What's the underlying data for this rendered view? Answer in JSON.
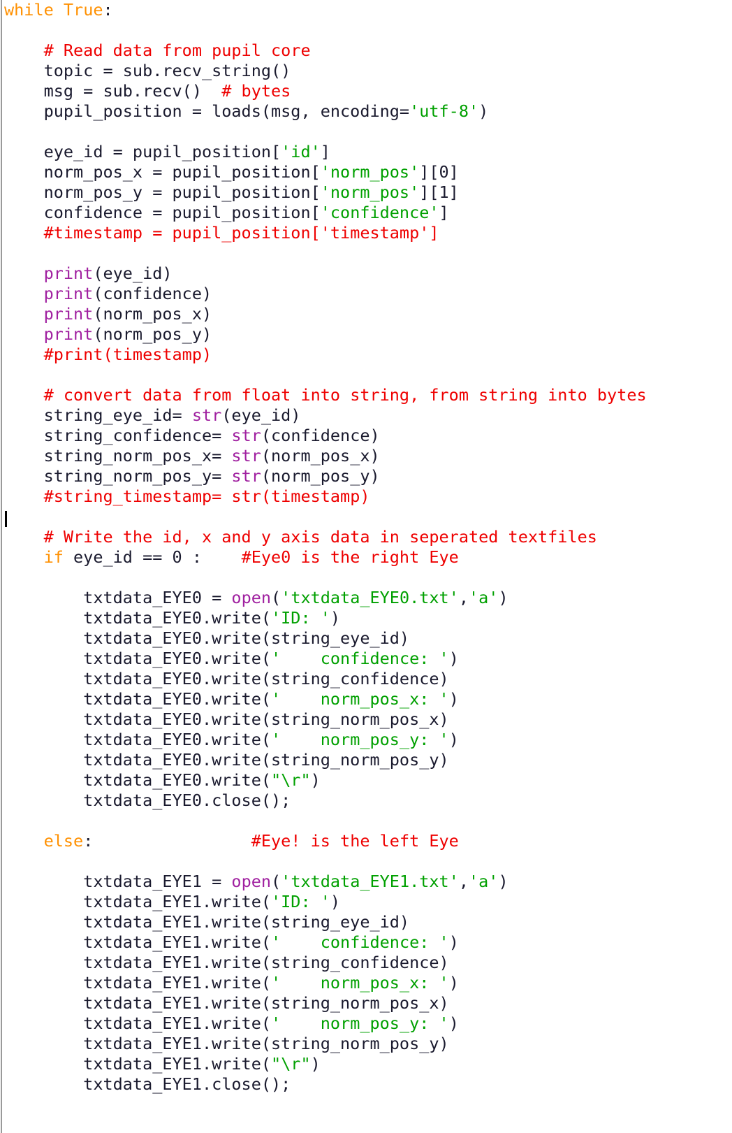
{
  "editor": {
    "language": "Python",
    "caret_line_index": 25,
    "colors": {
      "background": "#ffffff",
      "default_text": "#1a1a2e",
      "keyword": "#ff9000",
      "builtin": "#a020a0",
      "string": "#00a000",
      "comment": "#ee0000",
      "caret": "#000000",
      "gutter_rule": "#9a9a9a"
    }
  },
  "code": {
    "lines": [
      {
        "n": 1,
        "text": "while True:",
        "tokens": [
          {
            "t": "while",
            "c": "kw"
          },
          {
            "t": " ",
            "c": "plain"
          },
          {
            "t": "True",
            "c": "kw"
          },
          {
            "t": ":",
            "c": "plain"
          }
        ]
      },
      {
        "n": 2,
        "text": "",
        "tokens": []
      },
      {
        "n": 3,
        "text": "    # Read data from pupil core",
        "tokens": [
          {
            "t": "    ",
            "c": "plain"
          },
          {
            "t": "# Read data from pupil core",
            "c": "com"
          }
        ]
      },
      {
        "n": 4,
        "text": "    topic = sub.recv_string()",
        "tokens": [
          {
            "t": "    topic = sub.recv_string()",
            "c": "plain"
          }
        ]
      },
      {
        "n": 5,
        "text": "    msg = sub.recv()  # bytes",
        "tokens": [
          {
            "t": "    msg = sub.recv()  ",
            "c": "plain"
          },
          {
            "t": "# bytes",
            "c": "com"
          }
        ]
      },
      {
        "n": 6,
        "text": "    pupil_position = loads(msg, encoding='utf-8')",
        "tokens": [
          {
            "t": "    pupil_position = loads(msg, encoding=",
            "c": "plain"
          },
          {
            "t": "'utf-8'",
            "c": "str"
          },
          {
            "t": ")",
            "c": "plain"
          }
        ]
      },
      {
        "n": 7,
        "text": "",
        "tokens": []
      },
      {
        "n": 8,
        "text": "    eye_id = pupil_position['id']",
        "tokens": [
          {
            "t": "    eye_id = pupil_position[",
            "c": "plain"
          },
          {
            "t": "'id'",
            "c": "str"
          },
          {
            "t": "]",
            "c": "plain"
          }
        ]
      },
      {
        "n": 9,
        "text": "    norm_pos_x = pupil_position['norm_pos'][0]",
        "tokens": [
          {
            "t": "    norm_pos_x = pupil_position[",
            "c": "plain"
          },
          {
            "t": "'norm_pos'",
            "c": "str"
          },
          {
            "t": "][0]",
            "c": "plain"
          }
        ]
      },
      {
        "n": 10,
        "text": "    norm_pos_y = pupil_position['norm_pos'][1]",
        "tokens": [
          {
            "t": "    norm_pos_y = pupil_position[",
            "c": "plain"
          },
          {
            "t": "'norm_pos'",
            "c": "str"
          },
          {
            "t": "][1]",
            "c": "plain"
          }
        ]
      },
      {
        "n": 11,
        "text": "    confidence = pupil_position['confidence']",
        "tokens": [
          {
            "t": "    confidence = pupil_position[",
            "c": "plain"
          },
          {
            "t": "'confidence'",
            "c": "str"
          },
          {
            "t": "]",
            "c": "plain"
          }
        ]
      },
      {
        "n": 12,
        "text": "    #timestamp = pupil_position['timestamp']",
        "tokens": [
          {
            "t": "    ",
            "c": "plain"
          },
          {
            "t": "#timestamp = pupil_position['timestamp']",
            "c": "com"
          }
        ]
      },
      {
        "n": 13,
        "text": "",
        "tokens": []
      },
      {
        "n": 14,
        "text": "    print(eye_id)",
        "tokens": [
          {
            "t": "    ",
            "c": "plain"
          },
          {
            "t": "print",
            "c": "builtin"
          },
          {
            "t": "(eye_id)",
            "c": "plain"
          }
        ]
      },
      {
        "n": 15,
        "text": "    print(confidence)",
        "tokens": [
          {
            "t": "    ",
            "c": "plain"
          },
          {
            "t": "print",
            "c": "builtin"
          },
          {
            "t": "(confidence)",
            "c": "plain"
          }
        ]
      },
      {
        "n": 16,
        "text": "    print(norm_pos_x)",
        "tokens": [
          {
            "t": "    ",
            "c": "plain"
          },
          {
            "t": "print",
            "c": "builtin"
          },
          {
            "t": "(norm_pos_x)",
            "c": "plain"
          }
        ]
      },
      {
        "n": 17,
        "text": "    print(norm_pos_y)",
        "tokens": [
          {
            "t": "    ",
            "c": "plain"
          },
          {
            "t": "print",
            "c": "builtin"
          },
          {
            "t": "(norm_pos_y)",
            "c": "plain"
          }
        ]
      },
      {
        "n": 18,
        "text": "    #print(timestamp)",
        "tokens": [
          {
            "t": "    ",
            "c": "plain"
          },
          {
            "t": "#print(timestamp)",
            "c": "com"
          }
        ]
      },
      {
        "n": 19,
        "text": "",
        "tokens": []
      },
      {
        "n": 20,
        "text": "    # convert data from float into string, from string into bytes",
        "tokens": [
          {
            "t": "    ",
            "c": "plain"
          },
          {
            "t": "# convert data from float into string, from string into bytes",
            "c": "com"
          }
        ]
      },
      {
        "n": 21,
        "text": "    string_eye_id= str(eye_id)",
        "tokens": [
          {
            "t": "    string_eye_id= ",
            "c": "plain"
          },
          {
            "t": "str",
            "c": "builtin"
          },
          {
            "t": "(eye_id)",
            "c": "plain"
          }
        ]
      },
      {
        "n": 22,
        "text": "    string_confidence= str(confidence)",
        "tokens": [
          {
            "t": "    string_confidence= ",
            "c": "plain"
          },
          {
            "t": "str",
            "c": "builtin"
          },
          {
            "t": "(confidence)",
            "c": "plain"
          }
        ]
      },
      {
        "n": 23,
        "text": "    string_norm_pos_x= str(norm_pos_x)",
        "tokens": [
          {
            "t": "    string_norm_pos_x= ",
            "c": "plain"
          },
          {
            "t": "str",
            "c": "builtin"
          },
          {
            "t": "(norm_pos_x)",
            "c": "plain"
          }
        ]
      },
      {
        "n": 24,
        "text": "    string_norm_pos_y= str(norm_pos_y)",
        "tokens": [
          {
            "t": "    string_norm_pos_y= ",
            "c": "plain"
          },
          {
            "t": "str",
            "c": "builtin"
          },
          {
            "t": "(norm_pos_y)",
            "c": "plain"
          }
        ]
      },
      {
        "n": 25,
        "text": "    #string_timestamp= str(timestamp)",
        "tokens": [
          {
            "t": "    ",
            "c": "plain"
          },
          {
            "t": "#string_timestamp= str(timestamp)",
            "c": "com"
          }
        ]
      },
      {
        "n": 26,
        "text": "",
        "tokens": []
      },
      {
        "n": 27,
        "text": "    # Write the id, x and y axis data in seperated textfiles",
        "tokens": [
          {
            "t": "    ",
            "c": "plain"
          },
          {
            "t": "# Write the id, x and y axis data in seperated textfiles",
            "c": "com"
          }
        ]
      },
      {
        "n": 28,
        "text": "    if eye_id == 0 :    #Eye0 is the right Eye",
        "tokens": [
          {
            "t": "    ",
            "c": "plain"
          },
          {
            "t": "if",
            "c": "kw"
          },
          {
            "t": " eye_id == 0 :    ",
            "c": "plain"
          },
          {
            "t": "#Eye0 is the right Eye",
            "c": "com"
          }
        ]
      },
      {
        "n": 29,
        "text": "",
        "tokens": []
      },
      {
        "n": 30,
        "text": "        txtdata_EYE0 = open('txtdata_EYE0.txt','a')",
        "tokens": [
          {
            "t": "        txtdata_EYE0 = ",
            "c": "plain"
          },
          {
            "t": "open",
            "c": "builtin"
          },
          {
            "t": "(",
            "c": "plain"
          },
          {
            "t": "'txtdata_EYE0.txt'",
            "c": "str"
          },
          {
            "t": ",",
            "c": "plain"
          },
          {
            "t": "'a'",
            "c": "str"
          },
          {
            "t": ")",
            "c": "plain"
          }
        ]
      },
      {
        "n": 31,
        "text": "        txtdata_EYE0.write('ID: ')",
        "tokens": [
          {
            "t": "        txtdata_EYE0.write(",
            "c": "plain"
          },
          {
            "t": "'ID: '",
            "c": "str"
          },
          {
            "t": ")",
            "c": "plain"
          }
        ]
      },
      {
        "n": 32,
        "text": "        txtdata_EYE0.write(string_eye_id)",
        "tokens": [
          {
            "t": "        txtdata_EYE0.write(string_eye_id)",
            "c": "plain"
          }
        ]
      },
      {
        "n": 33,
        "text": "        txtdata_EYE0.write('    confidence: ')",
        "tokens": [
          {
            "t": "        txtdata_EYE0.write(",
            "c": "plain"
          },
          {
            "t": "'    confidence: '",
            "c": "str"
          },
          {
            "t": ")",
            "c": "plain"
          }
        ]
      },
      {
        "n": 34,
        "text": "        txtdata_EYE0.write(string_confidence)",
        "tokens": [
          {
            "t": "        txtdata_EYE0.write(string_confidence)",
            "c": "plain"
          }
        ]
      },
      {
        "n": 35,
        "text": "        txtdata_EYE0.write('    norm_pos_x: ')",
        "tokens": [
          {
            "t": "        txtdata_EYE0.write(",
            "c": "plain"
          },
          {
            "t": "'    norm_pos_x: '",
            "c": "str"
          },
          {
            "t": ")",
            "c": "plain"
          }
        ]
      },
      {
        "n": 36,
        "text": "        txtdata_EYE0.write(string_norm_pos_x)",
        "tokens": [
          {
            "t": "        txtdata_EYE0.write(string_norm_pos_x)",
            "c": "plain"
          }
        ]
      },
      {
        "n": 37,
        "text": "        txtdata_EYE0.write('    norm_pos_y: ')",
        "tokens": [
          {
            "t": "        txtdata_EYE0.write(",
            "c": "plain"
          },
          {
            "t": "'    norm_pos_y: '",
            "c": "str"
          },
          {
            "t": ")",
            "c": "plain"
          }
        ]
      },
      {
        "n": 38,
        "text": "        txtdata_EYE0.write(string_norm_pos_y)",
        "tokens": [
          {
            "t": "        txtdata_EYE0.write(string_norm_pos_y)",
            "c": "plain"
          }
        ]
      },
      {
        "n": 39,
        "text": "        txtdata_EYE0.write(\"\\r\")",
        "tokens": [
          {
            "t": "        txtdata_EYE0.write(",
            "c": "plain"
          },
          {
            "t": "\"\\r\"",
            "c": "str"
          },
          {
            "t": ")",
            "c": "plain"
          }
        ]
      },
      {
        "n": 40,
        "text": "        txtdata_EYE0.close();",
        "tokens": [
          {
            "t": "        txtdata_EYE0.close();",
            "c": "plain"
          }
        ]
      },
      {
        "n": 41,
        "text": "",
        "tokens": []
      },
      {
        "n": 42,
        "text": "    else:                #Eye! is the left Eye",
        "tokens": [
          {
            "t": "    ",
            "c": "plain"
          },
          {
            "t": "else",
            "c": "kw"
          },
          {
            "t": ":                ",
            "c": "plain"
          },
          {
            "t": "#Eye! is the left Eye",
            "c": "com"
          }
        ]
      },
      {
        "n": 43,
        "text": "",
        "tokens": []
      },
      {
        "n": 44,
        "text": "        txtdata_EYE1 = open('txtdata_EYE1.txt','a')",
        "tokens": [
          {
            "t": "        txtdata_EYE1 = ",
            "c": "plain"
          },
          {
            "t": "open",
            "c": "builtin"
          },
          {
            "t": "(",
            "c": "plain"
          },
          {
            "t": "'txtdata_EYE1.txt'",
            "c": "str"
          },
          {
            "t": ",",
            "c": "plain"
          },
          {
            "t": "'a'",
            "c": "str"
          },
          {
            "t": ")",
            "c": "plain"
          }
        ]
      },
      {
        "n": 45,
        "text": "        txtdata_EYE1.write('ID: ')",
        "tokens": [
          {
            "t": "        txtdata_EYE1.write(",
            "c": "plain"
          },
          {
            "t": "'ID: '",
            "c": "str"
          },
          {
            "t": ")",
            "c": "plain"
          }
        ]
      },
      {
        "n": 46,
        "text": "        txtdata_EYE1.write(string_eye_id)",
        "tokens": [
          {
            "t": "        txtdata_EYE1.write(string_eye_id)",
            "c": "plain"
          }
        ]
      },
      {
        "n": 47,
        "text": "        txtdata_EYE1.write('    confidence: ')",
        "tokens": [
          {
            "t": "        txtdata_EYE1.write(",
            "c": "plain"
          },
          {
            "t": "'    confidence: '",
            "c": "str"
          },
          {
            "t": ")",
            "c": "plain"
          }
        ]
      },
      {
        "n": 48,
        "text": "        txtdata_EYE1.write(string_confidence)",
        "tokens": [
          {
            "t": "        txtdata_EYE1.write(string_confidence)",
            "c": "plain"
          }
        ]
      },
      {
        "n": 49,
        "text": "        txtdata_EYE1.write('    norm_pos_x: ')",
        "tokens": [
          {
            "t": "        txtdata_EYE1.write(",
            "c": "plain"
          },
          {
            "t": "'    norm_pos_x: '",
            "c": "str"
          },
          {
            "t": ")",
            "c": "plain"
          }
        ]
      },
      {
        "n": 50,
        "text": "        txtdata_EYE1.write(string_norm_pos_x)",
        "tokens": [
          {
            "t": "        txtdata_EYE1.write(string_norm_pos_x)",
            "c": "plain"
          }
        ]
      },
      {
        "n": 51,
        "text": "        txtdata_EYE1.write('    norm_pos_y: ')",
        "tokens": [
          {
            "t": "        txtdata_EYE1.write(",
            "c": "plain"
          },
          {
            "t": "'    norm_pos_y: '",
            "c": "str"
          },
          {
            "t": ")",
            "c": "plain"
          }
        ]
      },
      {
        "n": 52,
        "text": "        txtdata_EYE1.write(string_norm_pos_y)",
        "tokens": [
          {
            "t": "        txtdata_EYE1.write(string_norm_pos_y)",
            "c": "plain"
          }
        ]
      },
      {
        "n": 53,
        "text": "        txtdata_EYE1.write(\"\\r\")",
        "tokens": [
          {
            "t": "        txtdata_EYE1.write(",
            "c": "plain"
          },
          {
            "t": "\"\\r\"",
            "c": "str"
          },
          {
            "t": ")",
            "c": "plain"
          }
        ]
      },
      {
        "n": 54,
        "text": "        txtdata_EYE1.close();",
        "tokens": [
          {
            "t": "        txtdata_EYE1.close();",
            "c": "plain"
          }
        ]
      }
    ]
  }
}
